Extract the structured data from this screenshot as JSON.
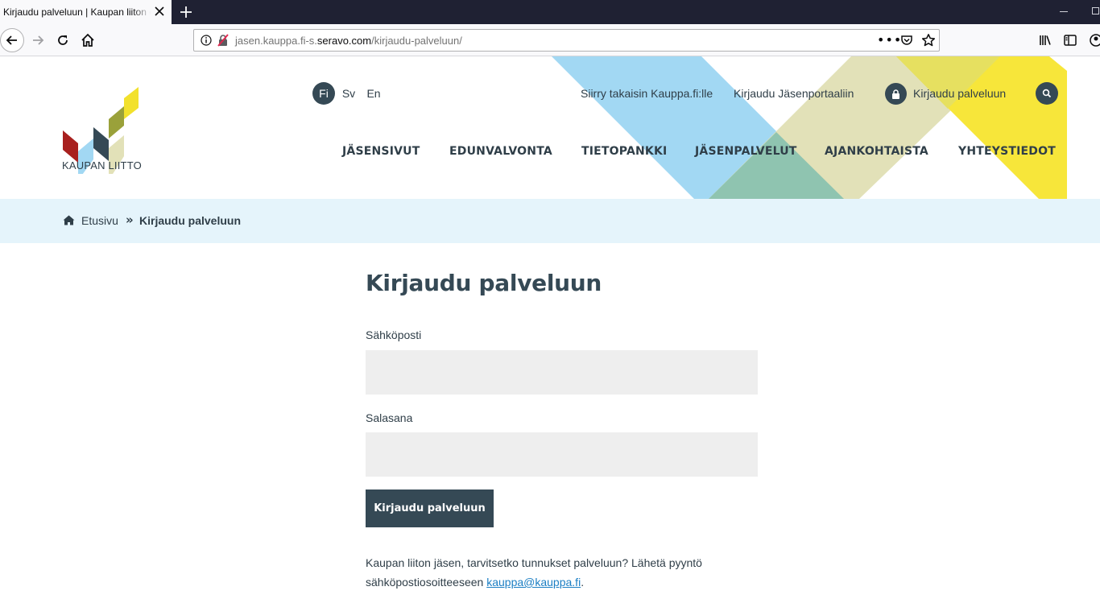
{
  "browser": {
    "tab_title": "Kirjaudu palveluun | Kaupan liiton e",
    "url_prefix": "jasen.kauppa.fi-s.",
    "url_domain": "seravo.com",
    "url_path": "/kirjaudu-palveluun/",
    "more_label": "•••"
  },
  "header": {
    "logo_text": "KAUPAN LIITTO",
    "languages": {
      "fi": "Fi",
      "sv": "Sv",
      "en": "En"
    },
    "utility": {
      "back_link": "Siirry takaisin Kauppa.fi:lle",
      "portal_link": "Kirjaudu Jäsenportaaliin",
      "login_link": "Kirjaudu palveluun"
    },
    "nav": [
      "JÄSENSIVUT",
      "EDUNVALVONTA",
      "TIETOPANKKI",
      "JÄSENPALVELUT",
      "AJANKOHTAISTA",
      "YHTEYSTIEDOT"
    ],
    "colors": {
      "dark": "#354955",
      "blue": "#a2d8f3",
      "olive": "#e2e1b8",
      "yellow": "#f7e63a",
      "teal": "#8fc4b0"
    }
  },
  "breadcrumb": {
    "home": "Etusivu",
    "separator": "»",
    "current": "Kirjaudu palveluun"
  },
  "form": {
    "title": "Kirjaudu palveluun",
    "email_label": "Sähköposti",
    "email_value": "",
    "password_label": "Salasana",
    "password_value": "",
    "submit_label": "Kirjaudu palveluun",
    "info_text": "Kaupan liiton jäsen, tarvitsetko tunnukset palveluun? Lähetä pyyntö sähköpostiosoitteeseen ",
    "info_link": "kauppa@kauppa.fi",
    "info_end": "."
  }
}
